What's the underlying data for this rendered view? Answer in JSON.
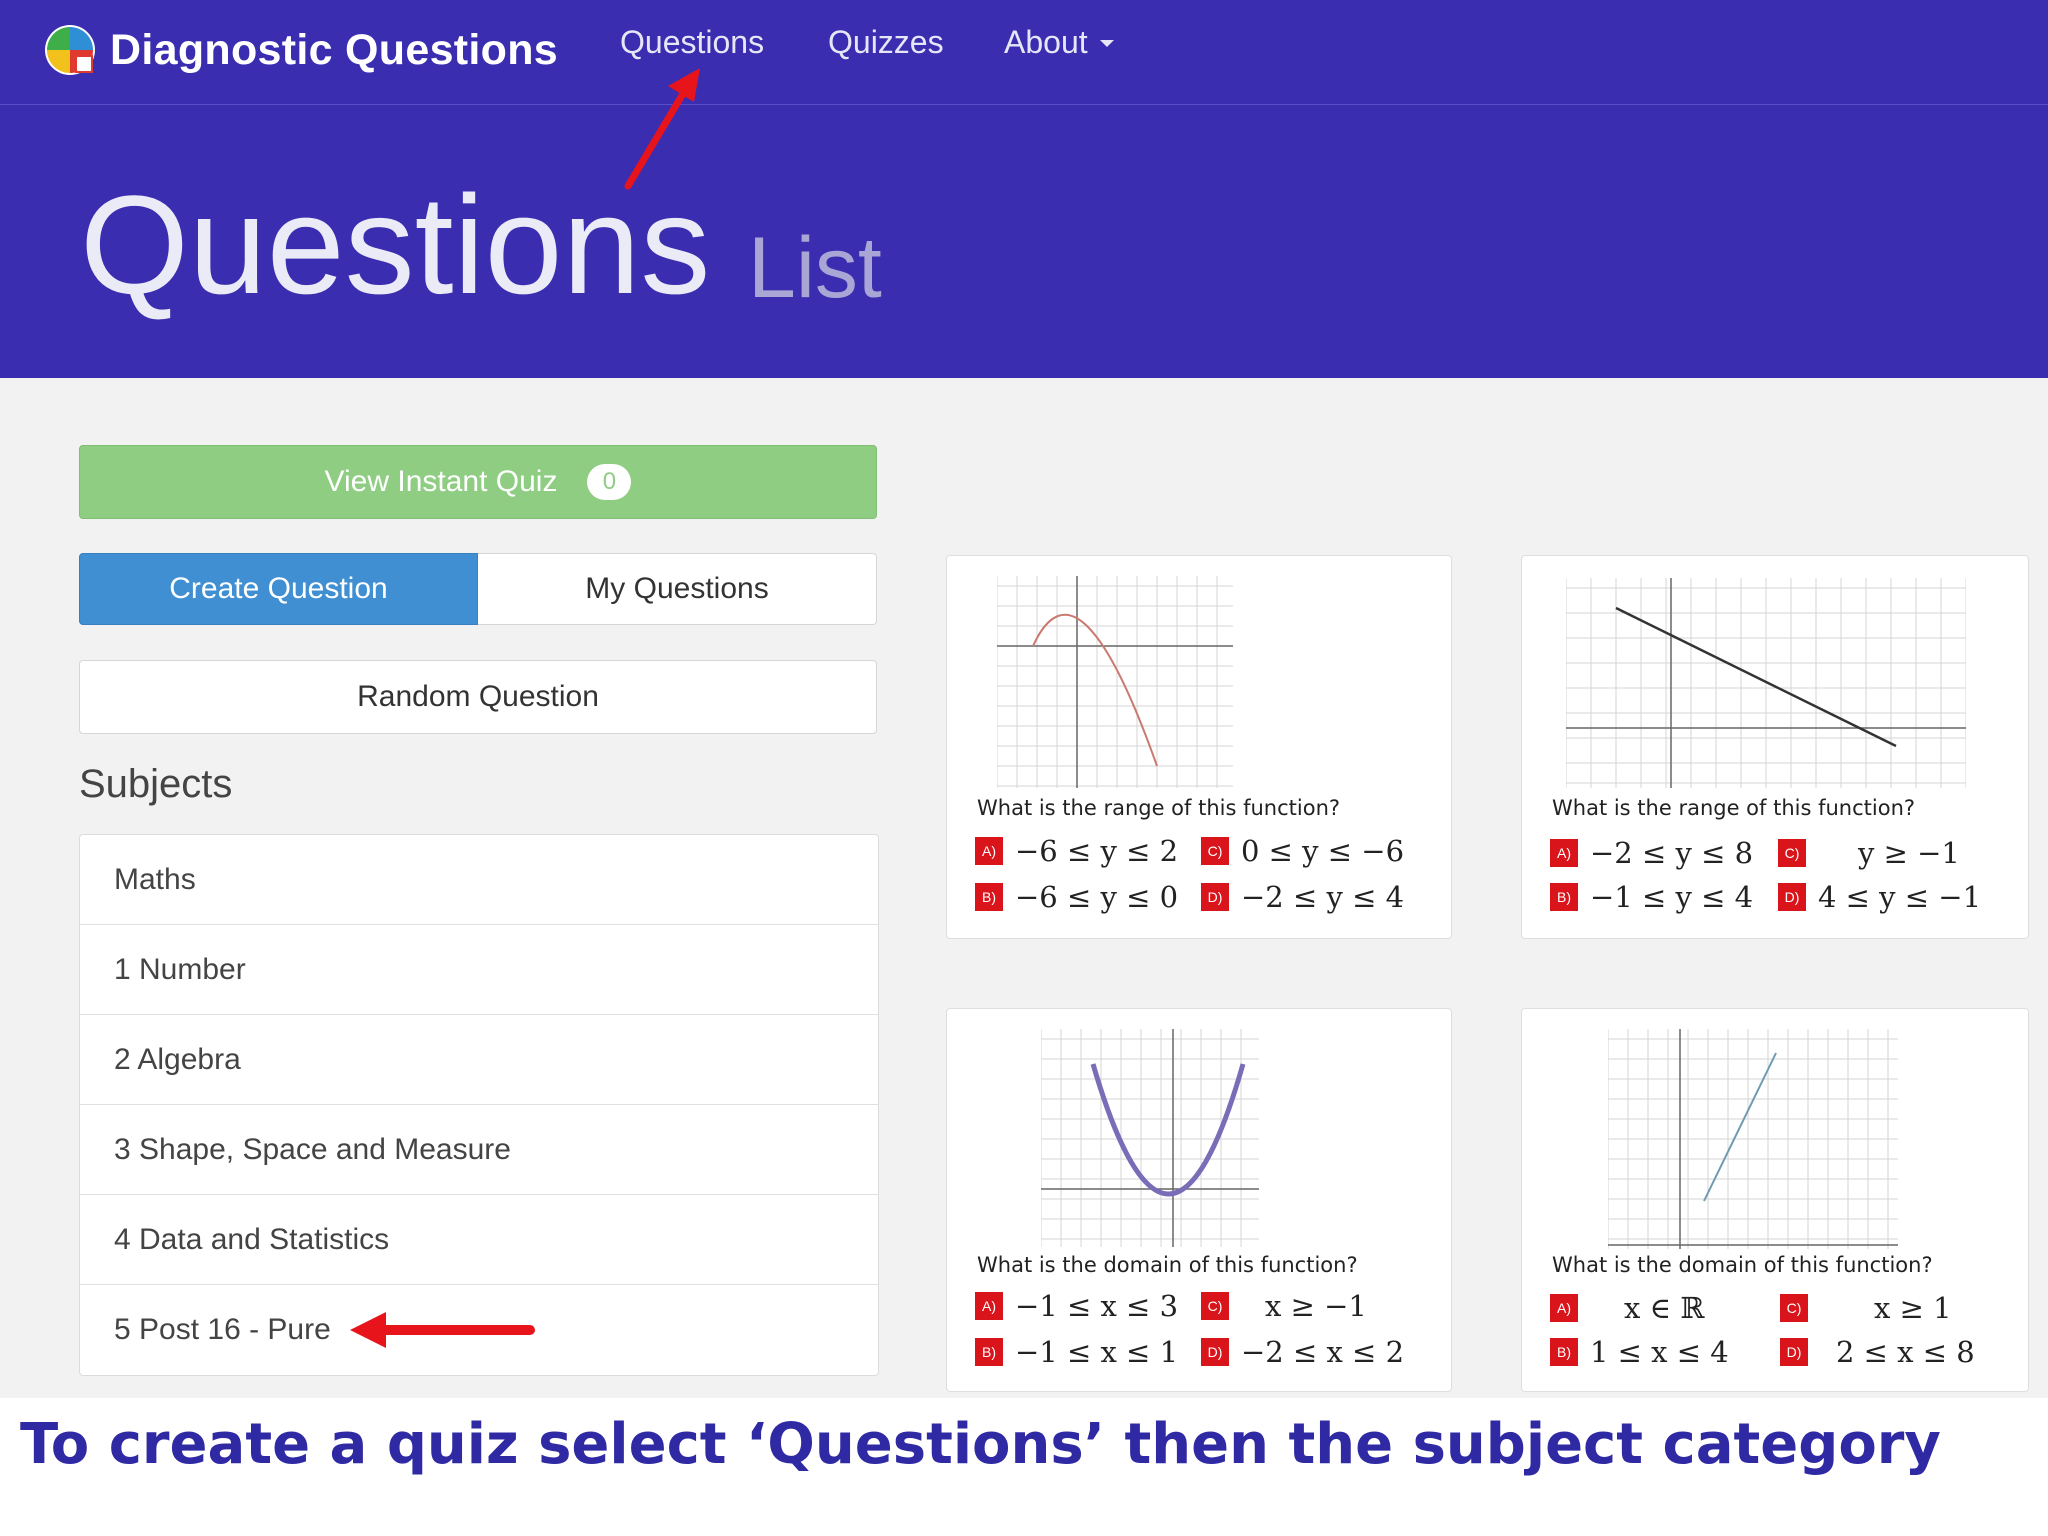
{
  "nav": {
    "brand": "Diagnostic Questions",
    "links": [
      "Questions",
      "Quizzes",
      "About"
    ],
    "about_caret_icon": "caret-down-icon"
  },
  "hero": {
    "title": "Questions",
    "subtitle": "List"
  },
  "actions": {
    "view_quiz": "View Instant Quiz",
    "quiz_count": "0",
    "create_question": "Create Question",
    "my_questions": "My Questions",
    "random_question": "Random Question"
  },
  "subjects": {
    "heading": "Subjects",
    "items": [
      "Maths",
      "1 Number",
      "2 Algebra",
      "3 Shape, Space and Measure",
      "4 Data and Statistics",
      "5 Post 16 - Pure"
    ]
  },
  "cards": [
    {
      "question": "What is the range of this function?",
      "options": [
        {
          "letter": "A)",
          "text": "−6 ≤ y ≤ 2"
        },
        {
          "letter": "C)",
          "text": "0 ≤ y ≤ −6"
        },
        {
          "letter": "B)",
          "text": "−6 ≤ y ≤ 0"
        },
        {
          "letter": "D)",
          "text": "−2 ≤ y ≤ 4"
        }
      ]
    },
    {
      "question": "What is the range of this function?",
      "options": [
        {
          "letter": "A)",
          "text": "−2 ≤ y ≤ 8"
        },
        {
          "letter": "C)",
          "text": "y ≥ −1"
        },
        {
          "letter": "B)",
          "text": "−1 ≤ y ≤ 4"
        },
        {
          "letter": "D)",
          "text": "4 ≤ y ≤ −1"
        }
      ]
    },
    {
      "question": "What is the domain of this function?",
      "options": [
        {
          "letter": "A)",
          "text": "−1 ≤ x ≤ 3"
        },
        {
          "letter": "C)",
          "text": "x ≥ −1"
        },
        {
          "letter": "B)",
          "text": "−1 ≤ x ≤ 1"
        },
        {
          "letter": "D)",
          "text": "−2 ≤ x ≤ 2"
        }
      ]
    },
    {
      "question": "What is the domain of this function?",
      "options": [
        {
          "letter": "A)",
          "text": "x ∈ ℝ"
        },
        {
          "letter": "C)",
          "text": "x ≥ 1"
        },
        {
          "letter": "B)",
          "text": "1 ≤ x ≤ 4"
        },
        {
          "letter": "D)",
          "text": "2 ≤ x ≤ 8"
        }
      ]
    }
  ],
  "caption": "To create a quiz select ‘Questions’ then the subject category",
  "colors": {
    "nav": "#3a2db0",
    "quiz_button": "#8fcd82",
    "create_button": "#3f8fd2",
    "option_badge": "#d9141b",
    "annotation_arrow": "#e8141b",
    "caption_text": "#2f2aa3"
  },
  "icons": {
    "brand_logo": "diagnostic-questions-logo-icon",
    "arrows": "red-arrow-annotation"
  }
}
